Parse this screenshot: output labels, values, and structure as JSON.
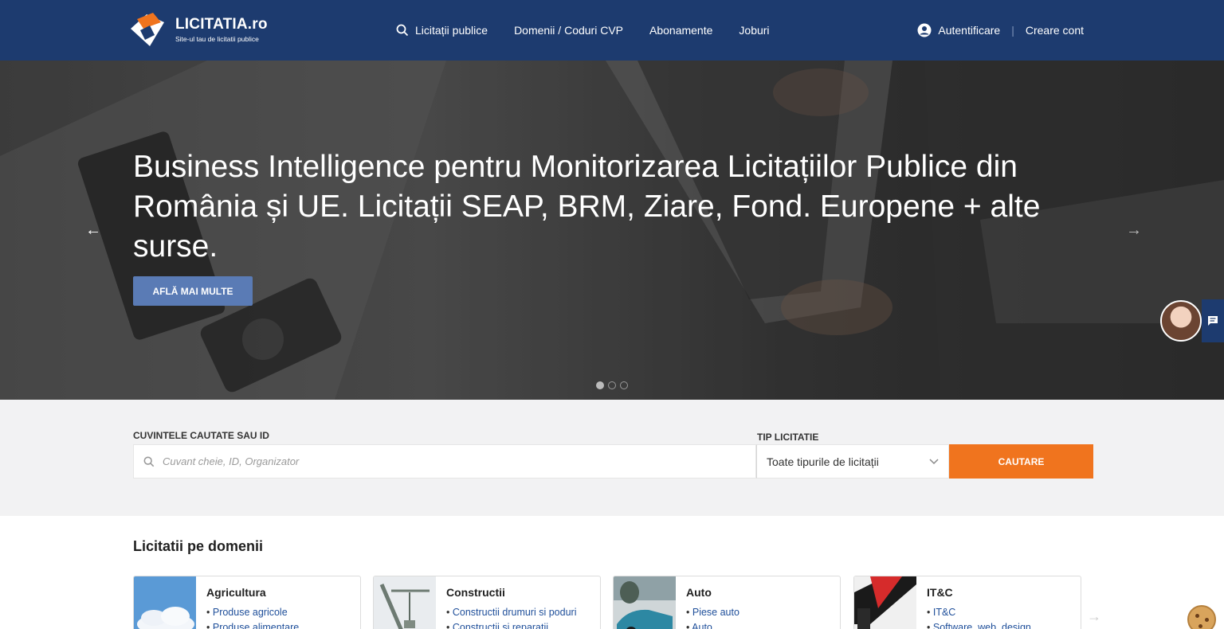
{
  "header": {
    "logo_name": "LICITATIA.ro",
    "logo_tagline": "Site-ul tau de licitatii publice",
    "nav": [
      {
        "label": "Licitații publice",
        "icon": "search-icon"
      },
      {
        "label": "Domenii / Coduri CVP"
      },
      {
        "label": "Abonamente"
      },
      {
        "label": "Joburi"
      }
    ],
    "login_label": "Autentificare",
    "signup_label": "Creare cont",
    "separator": "|"
  },
  "hero": {
    "title": "Business Intelligence pentru Monitorizarea Licitațiilor Publice din România și UE. Licitații SEAP, BRM, Ziare, Fond. Europene + alte surse.",
    "button_label": "AFLĂ MAI MULTE",
    "prev_arrow": "←",
    "next_arrow": "→",
    "slide_count": 3,
    "active_slide": 1
  },
  "search": {
    "keywords_label": "CUVINTELE CAUTATE SAU ID",
    "keywords_placeholder": "Cuvant cheie, ID, Organizator",
    "keywords_value": "",
    "type_label": "TIP LICITATIE",
    "type_value": "Toate tipurile de licitații",
    "submit_label": "CAUTARE"
  },
  "domains": {
    "title": "Licitatii pe domenii",
    "items": [
      {
        "name": "Agricultura",
        "subs": [
          "Produse agricole",
          "Produse alimentare"
        ]
      },
      {
        "name": "Constructii",
        "subs": [
          "Constructii drumuri si poduri",
          "Constructii si reparatii"
        ]
      },
      {
        "name": "Auto",
        "subs": [
          "Piese auto",
          "Auto"
        ]
      },
      {
        "name": "IT&C",
        "subs": [
          "IT&C",
          "Software, web, design"
        ]
      }
    ],
    "next_arrow": "→"
  },
  "colors": {
    "header_bg": "#1d3b6f",
    "accent_orange": "#f0741e",
    "hero_button": "#5a7bb5",
    "link_blue": "#1f4f9a"
  }
}
